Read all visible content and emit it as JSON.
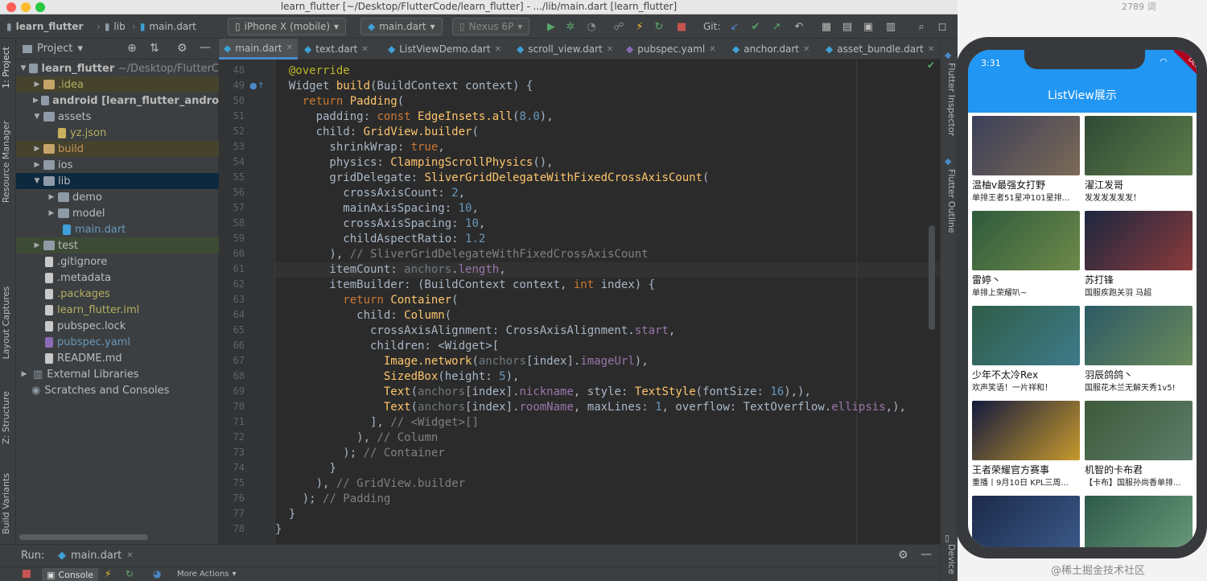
{
  "window_title": "learn_flutter [~/Desktop/FlutterCode/learn_flutter] - .../lib/main.dart [learn_flutter]",
  "word_count": "2789 词",
  "toolbar": {
    "breadcrumb": [
      "learn_flutter",
      "lib",
      "main.dart"
    ],
    "device": "iPhone X (mobile)",
    "run_config": "main.dart",
    "emulator": "Nexus 6P",
    "git_label": "Git:"
  },
  "tabs": [
    "main.dart",
    "text.dart",
    "ListViewDemo.dart",
    "scroll_view.dart",
    "pubspec.yaml",
    "anchor.dart",
    "asset_bundle.dart"
  ],
  "project_panel": {
    "title": "Project",
    "tree": [
      {
        "label": "learn_flutter",
        "extra": "~/Desktop/FlutterC",
        "kind": "folder"
      },
      {
        "label": ".idea",
        "kind": "folder-excl"
      },
      {
        "label": "android [learn_flutter_andro",
        "kind": "folder"
      },
      {
        "label": "assets",
        "kind": "folder"
      },
      {
        "label": "yz.json",
        "kind": "json"
      },
      {
        "label": "build",
        "kind": "folder-excl"
      },
      {
        "label": "ios",
        "kind": "folder"
      },
      {
        "label": "lib",
        "kind": "folder"
      },
      {
        "label": "demo",
        "kind": "folder"
      },
      {
        "label": "model",
        "kind": "folder"
      },
      {
        "label": "main.dart",
        "kind": "dart"
      },
      {
        "label": "test",
        "kind": "folder"
      },
      {
        "label": ".gitignore",
        "kind": "file"
      },
      {
        "label": ".metadata",
        "kind": "file"
      },
      {
        "label": ".packages",
        "kind": "file"
      },
      {
        "label": "learn_flutter.iml",
        "kind": "file"
      },
      {
        "label": "pubspec.lock",
        "kind": "file"
      },
      {
        "label": "pubspec.yaml",
        "kind": "yaml"
      },
      {
        "label": "README.md",
        "kind": "file"
      },
      {
        "label": "External Libraries",
        "kind": "lib"
      },
      {
        "label": "Scratches and Consoles",
        "kind": "scratch"
      }
    ]
  },
  "left_tools": [
    "1: Project",
    "Resource Manager",
    "Layout Captures",
    "Z: Structure",
    "Build Variants"
  ],
  "right_tools": [
    "Flutter Inspector",
    "Flutter Outline",
    "Device"
  ],
  "line_numbers": [
    "48",
    "49",
    "50",
    "51",
    "52",
    "53",
    "54",
    "55",
    "56",
    "57",
    "58",
    "59",
    "60",
    "61",
    "62",
    "63",
    "64",
    "65",
    "66",
    "67",
    "68",
    "69",
    "70",
    "71",
    "72",
    "73",
    "74",
    "75",
    "76",
    "77",
    "78",
    "79"
  ],
  "run_bar": {
    "label": "Run:",
    "config": "main.dart",
    "console": "Console",
    "more": "More Actions"
  },
  "phone": {
    "time": "3:31",
    "debug_banner": "DEBUG",
    "app_title": "ListView展示",
    "items": [
      {
        "nick": "温柚v最强女打野",
        "room": "单排王者51星冲101星排...",
        "colors": [
          "#3b3f5a",
          "#7c6a56"
        ]
      },
      {
        "nick": "濯江发哥",
        "room": "发发发发发发！",
        "colors": [
          "#2f4a35",
          "#5e7d4a"
        ]
      },
      {
        "nick": "雷婷丶",
        "room": "单排上荣耀叭~",
        "colors": [
          "#2e5a3b",
          "#6e8a4a"
        ]
      },
      {
        "nick": "苏打锋",
        "room": "国服疾跑关羽 马超",
        "colors": [
          "#1d2740",
          "#8a3b3b"
        ]
      },
      {
        "nick": "少年不太冷Rex",
        "room": "欢声笑语！一片祥和！",
        "colors": [
          "#2f5d48",
          "#3e7a8a"
        ]
      },
      {
        "nick": "羽辰鸽鸽丶",
        "room": "国服花木兰无解天秀1v5!",
        "colors": [
          "#2d5a66",
          "#6a8a5a"
        ]
      },
      {
        "nick": "王者荣耀官方赛事",
        "room": "重播丨9月10日 KPL三周...",
        "colors": [
          "#141a3d",
          "#c79a2d"
        ]
      },
      {
        "nick": "机智的卡布君",
        "room": "【卡布】国服孙尚香单排...",
        "colors": [
          "#3d5a3a",
          "#5e7d6a"
        ]
      },
      {
        "nick": "",
        "room": "",
        "colors": [
          "#1c2a4a",
          "#3b5a8a"
        ]
      },
      {
        "nick": "",
        "room": "",
        "colors": [
          "#2e5a4a",
          "#6a9a7a"
        ]
      }
    ]
  },
  "watermark": "@稀土掘金技术社区",
  "colors": {
    "ide_bg": "#2b2b2b",
    "panel": "#3c3f41",
    "app_bar": "#2196f3",
    "selection": "#0d293e"
  }
}
